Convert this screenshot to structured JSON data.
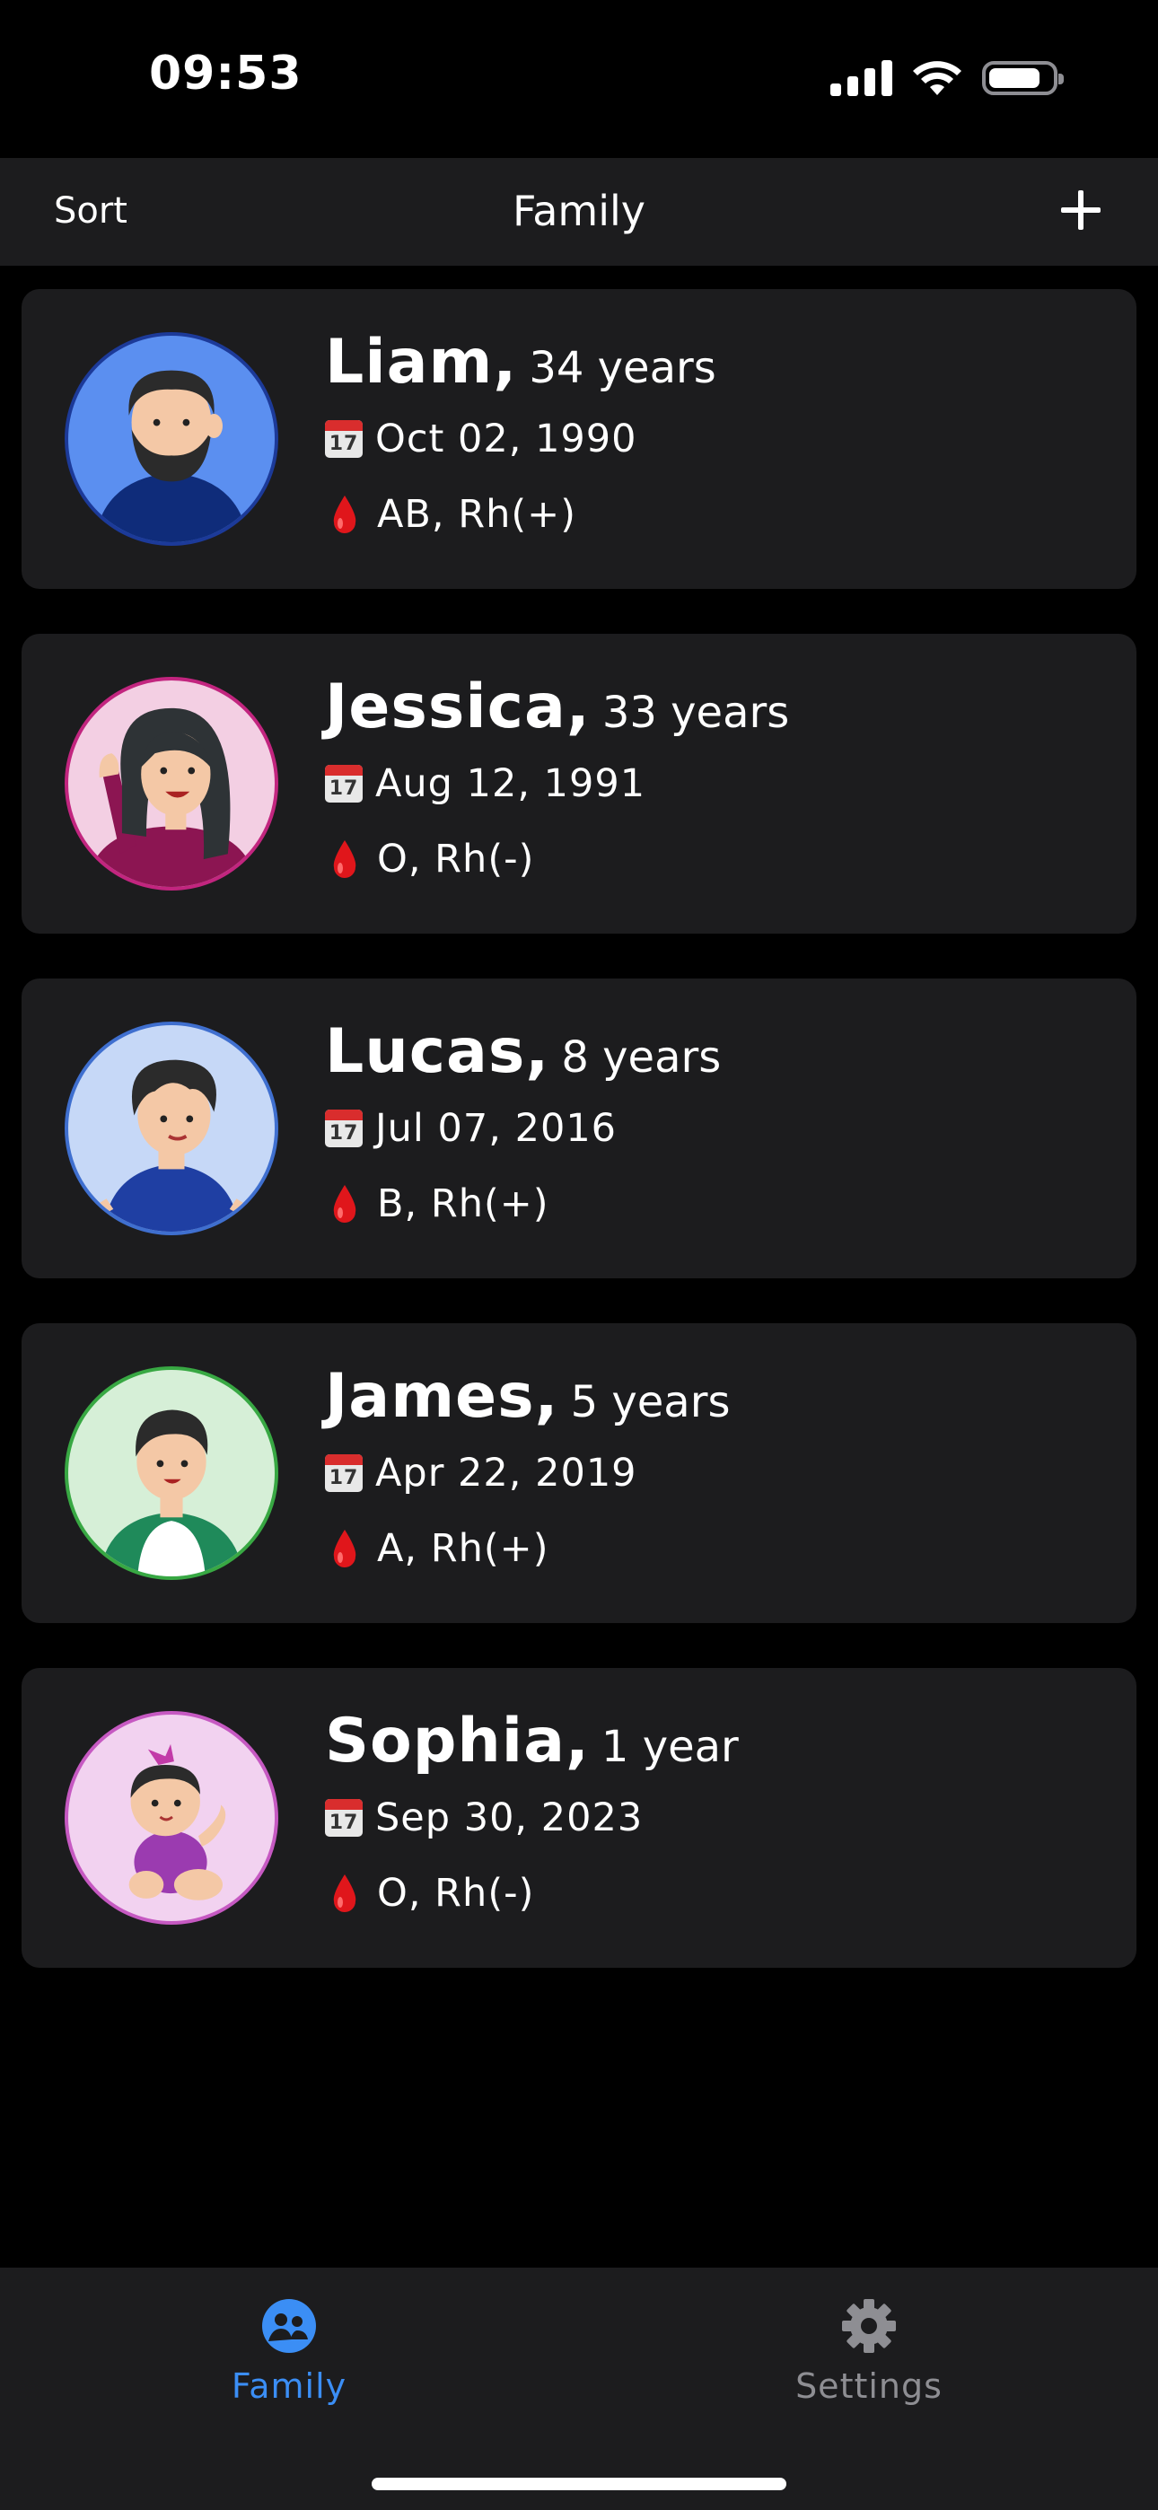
{
  "status_bar": {
    "time": "09:53"
  },
  "nav": {
    "sort_label": "Sort",
    "title": "Family",
    "add_icon": "plus-icon"
  },
  "family": [
    {
      "name": "Liam,",
      "age": "34 years",
      "birthday": "Oct 02, 1990",
      "blood_type": "AB, Rh(+)",
      "avatar_bg": "#5b8ff0",
      "avatar_border": "#1c3a99"
    },
    {
      "name": "Jessica,",
      "age": "33 years",
      "birthday": "Aug 12, 1991",
      "blood_type": "O, Rh(-)",
      "avatar_bg": "#f3cfe3",
      "avatar_border": "#c2257f"
    },
    {
      "name": "Lucas,",
      "age": "8 years",
      "birthday": "Jul 07, 2016",
      "blood_type": "B, Rh(+)",
      "avatar_bg": "#c6d8f7",
      "avatar_border": "#3f6fcf"
    },
    {
      "name": "James,",
      "age": "5 years",
      "birthday": "Apr 22, 2019",
      "blood_type": "A, Rh(+)",
      "avatar_bg": "#d6efd7",
      "avatar_border": "#38a843"
    },
    {
      "name": "Sophia,",
      "age": "1 year",
      "birthday": "Sep 30, 2023",
      "blood_type": "O, Rh(-)",
      "avatar_bg": "#f2d2f0",
      "avatar_border": "#c659c2"
    }
  ],
  "calendar_icon_number": "17",
  "tabs": [
    {
      "label": "Family",
      "icon": "family-icon",
      "active": true
    },
    {
      "label": "Settings",
      "icon": "gear-icon",
      "active": false
    }
  ],
  "colors": {
    "accent": "#3b8ef5",
    "card_bg": "#1c1c1e",
    "page_bg": "#000000",
    "blood_drop": "#e0161b"
  }
}
